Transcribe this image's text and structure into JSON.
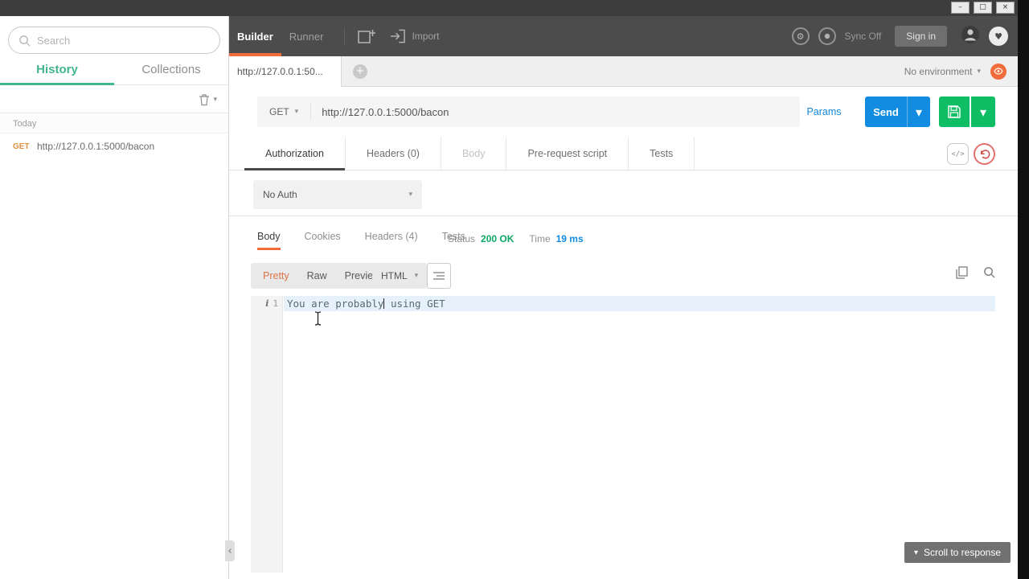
{
  "window": {
    "minimize_glyph": "–",
    "restore_glyph": "□",
    "close_glyph": "×"
  },
  "glyphs": {
    "chevron_down": "▾",
    "chevron_left": "‹",
    "plus": "+",
    "heart": "♥",
    "gear": "⚙",
    "code": "</>",
    "info": "i"
  },
  "sidebar": {
    "search": {
      "placeholder": "Search"
    },
    "tabs": {
      "history": "History",
      "collections": "Collections"
    },
    "today_label": "Today",
    "history": [
      {
        "method": "GET",
        "url": "http://127.0.0.1:5000/bacon"
      }
    ]
  },
  "topbar": {
    "builder": "Builder",
    "runner": "Runner",
    "import": "Import",
    "sync": "Sync Off",
    "sign_in": "Sign in"
  },
  "tabstrip": {
    "active_tab": "http://127.0.0.1:50...",
    "environment": "No environment"
  },
  "request": {
    "method": "GET",
    "url": "http://127.0.0.1:5000/bacon",
    "params": "Params",
    "send": "Send",
    "tabs": {
      "authorization": "Authorization",
      "headers": "Headers (0)",
      "body": "Body",
      "prerequest": "Pre-request script",
      "tests": "Tests"
    },
    "auth_type": "No Auth"
  },
  "response": {
    "tabs": {
      "body": "Body",
      "cookies": "Cookies",
      "headers": "Headers (4)",
      "tests": "Tests"
    },
    "status_label": "Status",
    "status_value": "200 OK",
    "time_label": "Time",
    "time_value": "19 ms",
    "views": {
      "pretty": "Pretty",
      "raw": "Raw",
      "preview": "Preview"
    },
    "format": "HTML",
    "editor": {
      "line_number": "1",
      "text_before_cursor": "You are probably",
      "text_after_cursor": " using GET"
    },
    "scroll_button": "Scroll to response"
  },
  "colors": {
    "brand_orange": "#f26b3a",
    "history_active_teal": "#42b491",
    "send_button_blue": "#118ce1",
    "save_button_green": "#0fbd65",
    "status_ok_green": "#0ca867",
    "time_blue": "#118ce1",
    "method_get_orange": "#e09143"
  }
}
